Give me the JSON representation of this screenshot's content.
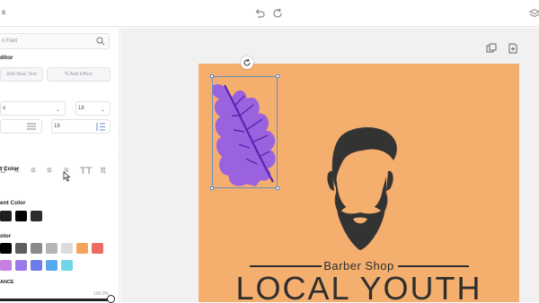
{
  "topbar": {
    "crumb": "s"
  },
  "panel": {
    "search_placeholder": "n Font",
    "editor_title": "ditor",
    "add_text": "Add New Text",
    "add_effect": "Add Effect",
    "font_family_value": "o",
    "font_size_value": "18",
    "letter_spacing_value": "",
    "line_height_value": "18",
    "text_color_title": "t Color",
    "recent_color_title": "ent Color",
    "color_title": "olor",
    "balance_title": "ANCE",
    "opacity_value": "100.0%",
    "recent_colors": [
      "#1f1f1f",
      "#050505",
      "#2b2b2b"
    ],
    "palette_row1": [
      "#000000",
      "#5e5e5e",
      "#8a8a8a",
      "#b5b5b5",
      "#dcdcdc",
      "#f3a55b",
      "#ee6b62"
    ],
    "palette_row2": [
      "#c77ee0",
      "#9a79e8",
      "#6d7bea",
      "#57a9ef",
      "#6fd6e8"
    ],
    "opacity_level": 1.0
  },
  "canvas": {
    "subtitle": "Barber Shop",
    "title": "LOCAL YOUTH",
    "background": "#f4ae6e",
    "leaf_color": "#9b62e0"
  }
}
